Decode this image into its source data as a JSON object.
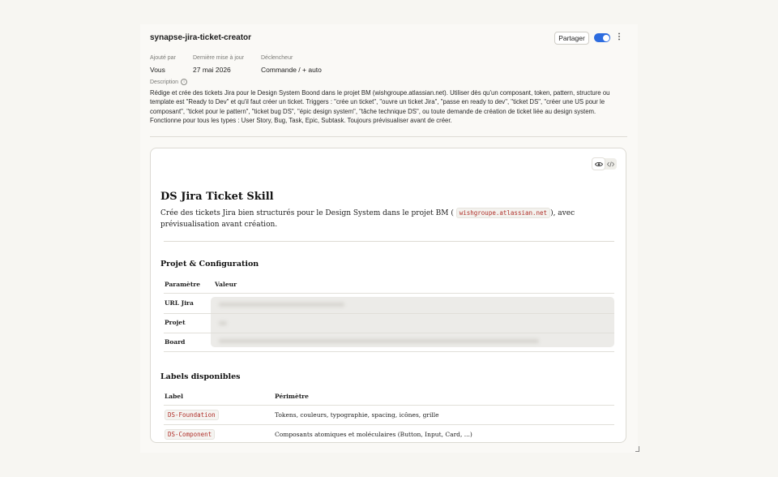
{
  "header": {
    "title": "synapse-jira-ticket-creator",
    "share_label": "Partager",
    "toggle_on": true,
    "more_label": "⋮"
  },
  "meta": {
    "added_by_label": "Ajouté par",
    "added_by_value": "Vous",
    "updated_label": "Dernière mise à jour",
    "updated_value": "27 mai 2026",
    "trigger_label": "Déclencheur",
    "trigger_value": "Commande / + auto"
  },
  "description": {
    "label": "Description",
    "text": "Rédige et crée des tickets Jira pour le Design System Boond dans le projet BM (wishgroupe.atlassian.net). Utiliser dès qu'un composant, token, pattern, structure ou template est \"Ready to Dev\" et qu'il faut créer un ticket. Triggers : \"crée un ticket\", \"ouvre un ticket Jira\", \"passe en ready to dev\", \"ticket DS\", \"créer une US pour le composant\", \"ticket pour le pattern\", \"ticket bug DS\", \"épic design system\", \"tâche technique DS\", ou toute demande de création de ticket liée au design system. Fonctionne pour tous les types : User Story, Bug, Task, Epic, Subtask. Toujours prévisualiser avant de créer."
  },
  "doc": {
    "title": "DS Jira Ticket Skill",
    "intro_before": "Crée des tickets Jira bien structurés pour le Design System dans le projet BM (",
    "intro_code": "wishgroupe.atlassian.net",
    "intro_after": "), avec prévisualisation avant création.",
    "section1_title": "Projet & Configuration",
    "config_table": {
      "headers": [
        "Paramètre",
        "Valeur"
      ],
      "rows": [
        {
          "param": "URL Jira"
        },
        {
          "param": "Projet"
        },
        {
          "param": "Board"
        }
      ]
    },
    "section2_title": "Labels disponibles",
    "labels_table": {
      "headers": [
        "Label",
        "Périmètre"
      ],
      "rows": [
        {
          "label": "DS-Foundation",
          "scope": "Tokens, couleurs, typographie, spacing, icônes, grille"
        },
        {
          "label": "DS-Component",
          "scope": "Composants atomiques et moléculaires (Button, Input, Card, ...)"
        }
      ]
    }
  }
}
